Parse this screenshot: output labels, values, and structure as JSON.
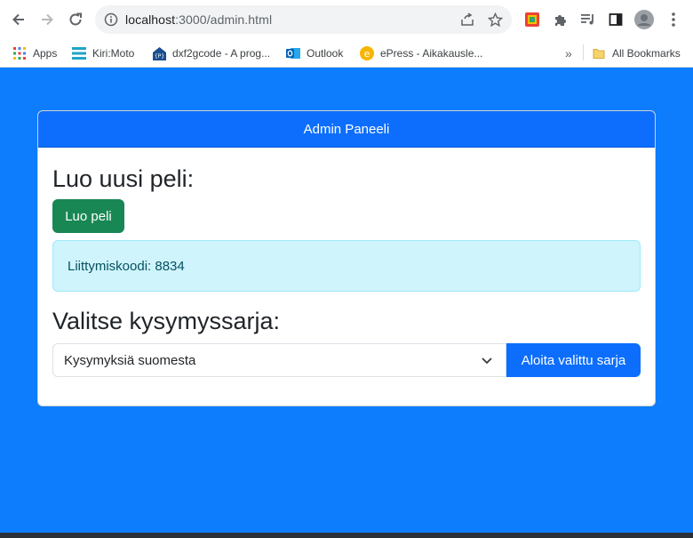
{
  "browser": {
    "url_host": "localhost",
    "url_rest": ":3000/admin.html",
    "bookmarks": [
      {
        "label": "Apps",
        "icon": "apps-grid-icon"
      },
      {
        "label": "Kiri:Moto",
        "icon": "kirimoto-icon"
      },
      {
        "label": "dxf2gcode - A prog...",
        "icon": "dxf2gcode-icon"
      },
      {
        "label": "Outlook",
        "icon": "outlook-icon"
      },
      {
        "label": "ePress - Aikakausle...",
        "icon": "epress-icon"
      }
    ],
    "all_bookmarks": "All Bookmarks"
  },
  "admin": {
    "header": "Admin Paneeli",
    "create_heading": "Luo uusi peli:",
    "create_button": "Luo peli",
    "join_code": "Liittymiskoodi: 8834",
    "select_heading": "Valitse kysymyssarja:",
    "selected_set": "Kysymyksiä suomesta",
    "start_button": "Aloita valittu sarja"
  },
  "colors": {
    "page_bg": "#0d7dfd",
    "header_bg": "#0d6efd",
    "success": "#198754",
    "info_bg": "#cff4fc"
  }
}
